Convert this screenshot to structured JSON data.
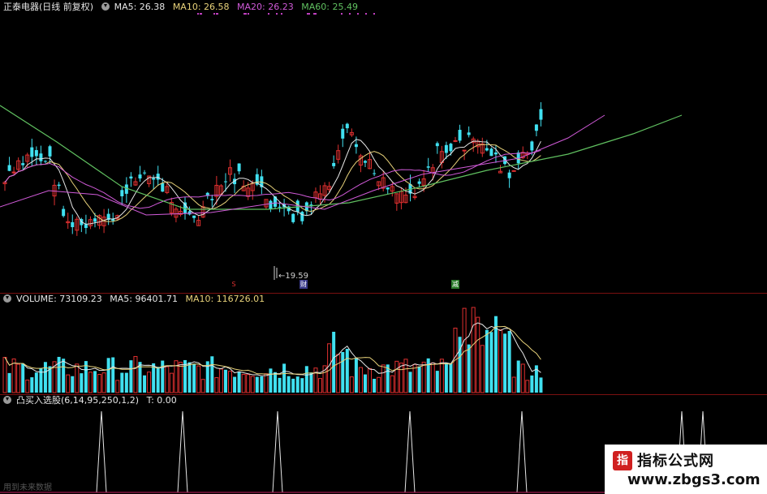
{
  "price_panel": {
    "stock_name": "正泰电器",
    "period": "(日线 前复权)",
    "ma5": "MA5: 26.38",
    "ma10": "MA10: 26.58",
    "ma20": "MA20: 26.23",
    "ma60": "MA60: 25.49",
    "low_marker": "←19.59",
    "badge_s": "S",
    "badge_cai": "财",
    "badge_jian": "减"
  },
  "volume_panel": {
    "volume": "VOLUME: 73109.23",
    "ma5": "MA5: 96401.71",
    "ma10": "MA10: 116726.01"
  },
  "indicator_panel": {
    "name": "凸买入选股(6,14,95,250,1,2)",
    "t_value": "T: 0.00",
    "footer": "用到未来数据"
  },
  "watermark": {
    "line1": "指标公式网",
    "line2": "www.zbgs3.com"
  },
  "colors": {
    "up": "#e03030",
    "down": "#40e0f0",
    "ma5": "#e6e6e6",
    "ma10": "#e8d27a",
    "ma20": "#d05ad8",
    "ma60": "#60c060",
    "divider": "#7a1010"
  }
}
